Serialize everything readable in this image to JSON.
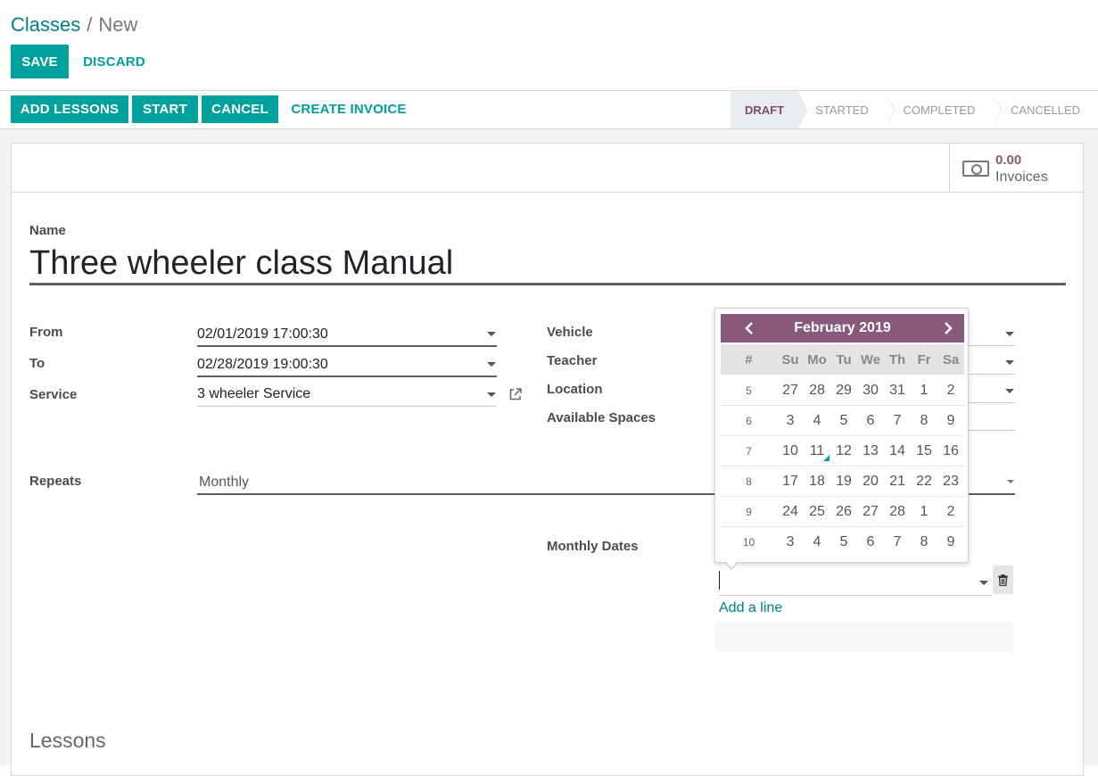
{
  "breadcrumb": {
    "parent": "Classes",
    "separator": "/",
    "current": "New"
  },
  "actions": {
    "save": "SAVE",
    "discard": "DISCARD"
  },
  "header_buttons": {
    "add_lessons": "ADD LESSONS",
    "start": "START",
    "cancel": "CANCEL",
    "create_invoice": "CREATE INVOICE"
  },
  "stages": [
    {
      "label": "DRAFT",
      "active": true
    },
    {
      "label": "STARTED",
      "active": false
    },
    {
      "label": "COMPLETED",
      "active": false
    },
    {
      "label": "CANCELLED",
      "active": false
    }
  ],
  "stat_button": {
    "value": "0.00",
    "label": "Invoices",
    "icon": "money-icon"
  },
  "form": {
    "name_label": "Name",
    "name_value": "Three wheeler class Manual",
    "from_label": "From",
    "from_value": "02/01/2019 17:00:30",
    "to_label": "To",
    "to_value": "02/28/2019 19:00:30",
    "service_label": "Service",
    "service_value": "3 wheeler Service",
    "vehicle_label": "Vehicle",
    "teacher_label": "Teacher",
    "location_label": "Location",
    "available_spaces_label": "Available Spaces",
    "repeats_label": "Repeats",
    "repeats_value": "Monthly",
    "monthly_dates_label": "Monthly Dates",
    "add_line": "Add a line",
    "lessons_title": "Lessons"
  },
  "datepicker": {
    "title": "February 2019",
    "header_color": "#875A7B",
    "week_header": "#",
    "days_of_week": [
      "Su",
      "Mo",
      "Tu",
      "We",
      "Th",
      "Fr",
      "Sa"
    ],
    "today": "11",
    "weeks": [
      {
        "week": "5",
        "days": [
          "27",
          "28",
          "29",
          "30",
          "31",
          "1",
          "2"
        ]
      },
      {
        "week": "6",
        "days": [
          "3",
          "4",
          "5",
          "6",
          "7",
          "8",
          "9"
        ]
      },
      {
        "week": "7",
        "days": [
          "10",
          "11",
          "12",
          "13",
          "14",
          "15",
          "16"
        ]
      },
      {
        "week": "8",
        "days": [
          "17",
          "18",
          "19",
          "20",
          "21",
          "22",
          "23"
        ]
      },
      {
        "week": "9",
        "days": [
          "24",
          "25",
          "26",
          "27",
          "28",
          "1",
          "2"
        ]
      },
      {
        "week": "10",
        "days": [
          "3",
          "4",
          "5",
          "6",
          "7",
          "8",
          "9"
        ]
      }
    ]
  },
  "colors": {
    "primary": "#00A09D",
    "brand": "#875A7B",
    "link": "#00808a"
  }
}
